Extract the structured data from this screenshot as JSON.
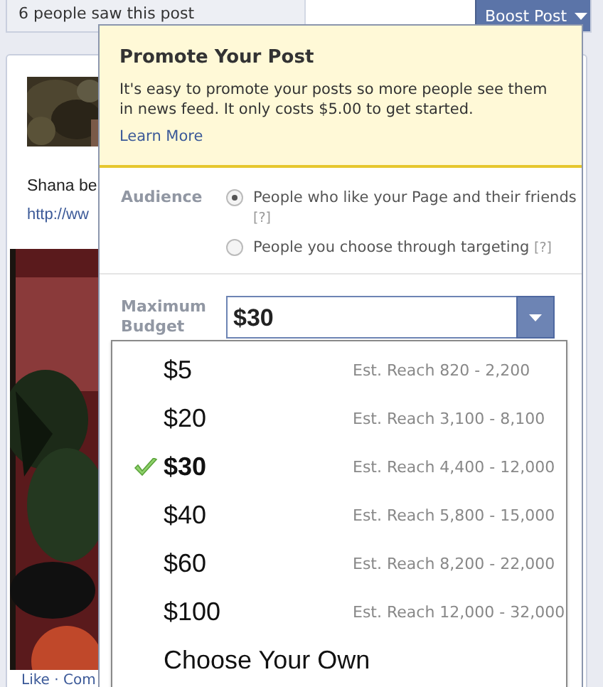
{
  "post_stats": {
    "reach": "6 people saw this post",
    "boost_button": "Boost Post"
  },
  "post": {
    "text": "Shana be",
    "link": "http://ww",
    "actions": "Like · Com"
  },
  "promote": {
    "title": "Promote Your Post",
    "description": "It's easy to promote your posts so more people see them in news feed. It only costs $5.00 to get started.",
    "learn_more": "Learn More",
    "audience": {
      "label": "Audience",
      "options": [
        {
          "label": "People who like your Page and their friends",
          "help": "[?]",
          "selected": true
        },
        {
          "label": "People you choose through targeting",
          "help": "[?]",
          "selected": false
        }
      ]
    },
    "budget": {
      "label": "Maximum Budget",
      "value": "$30",
      "expanded": true,
      "options": [
        {
          "amount": "$5",
          "reach": "Est. Reach 820 - 2,200",
          "selected": false
        },
        {
          "amount": "$20",
          "reach": "Est. Reach 3,100 - 8,100",
          "selected": false
        },
        {
          "amount": "$30",
          "reach": "Est. Reach 4,400 - 12,000",
          "selected": true
        },
        {
          "amount": "$40",
          "reach": "Est. Reach 5,800 - 15,000",
          "selected": false
        },
        {
          "amount": "$60",
          "reach": "Est. Reach 8,200 - 22,000",
          "selected": false
        },
        {
          "amount": "$100",
          "reach": "Est. Reach 12,000 - 32,000",
          "selected": false
        },
        {
          "amount": "Choose Your Own",
          "selected": false
        }
      ]
    }
  }
}
